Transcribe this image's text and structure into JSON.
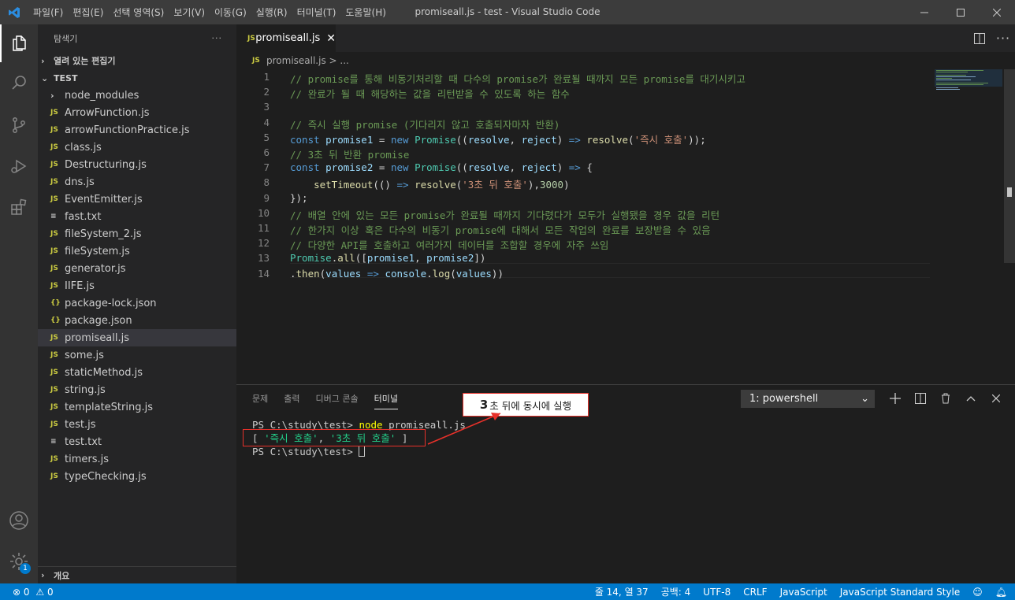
{
  "titlebar": {
    "menus": [
      "파일(F)",
      "편집(E)",
      "선택 영역(S)",
      "보기(V)",
      "이동(G)",
      "실행(R)",
      "터미널(T)",
      "도움말(H)"
    ],
    "title": "promiseall.js - test - Visual Studio Code"
  },
  "sidebar": {
    "header": "탐색기",
    "more": "···",
    "open_editors": "열려 있는 편집기",
    "folder": "TEST",
    "outline": "개요",
    "files": [
      {
        "name": "node_modules",
        "kind": "folder"
      },
      {
        "name": "ArrowFunction.js",
        "kind": "js"
      },
      {
        "name": "arrowFunctionPractice.js",
        "kind": "js"
      },
      {
        "name": "class.js",
        "kind": "js"
      },
      {
        "name": "Destructuring.js",
        "kind": "js"
      },
      {
        "name": "dns.js",
        "kind": "js"
      },
      {
        "name": "EventEmitter.js",
        "kind": "js"
      },
      {
        "name": "fast.txt",
        "kind": "txt"
      },
      {
        "name": "fileSystem_2.js",
        "kind": "js"
      },
      {
        "name": "fileSystem.js",
        "kind": "js"
      },
      {
        "name": "generator.js",
        "kind": "js"
      },
      {
        "name": "IIFE.js",
        "kind": "js"
      },
      {
        "name": "package-lock.json",
        "kind": "json"
      },
      {
        "name": "package.json",
        "kind": "json"
      },
      {
        "name": "promiseall.js",
        "kind": "js",
        "selected": true
      },
      {
        "name": "some.js",
        "kind": "js"
      },
      {
        "name": "staticMethod.js",
        "kind": "js"
      },
      {
        "name": "string.js",
        "kind": "js"
      },
      {
        "name": "templateString.js",
        "kind": "js"
      },
      {
        "name": "test.js",
        "kind": "js"
      },
      {
        "name": "test.txt",
        "kind": "txt"
      },
      {
        "name": "timers.js",
        "kind": "js"
      },
      {
        "name": "typeChecking.js",
        "kind": "js"
      }
    ]
  },
  "editor": {
    "tab": "promiseall.js",
    "breadcrumb": "promiseall.js > ...",
    "js_badge": "JS",
    "lines": [
      [
        [
          "c",
          "// promise를 통해 비동기처리할 때 다수의 promise가 완료될 때까지 모든 promise를 대기시키고"
        ]
      ],
      [
        [
          "c",
          "// 완료가 될 때 해당하는 값을 리턴받을 수 있도록 하는 함수"
        ]
      ],
      [],
      [
        [
          "c",
          "// 즉시 실행 promise (기다리지 않고 호출되자마자 반환)"
        ]
      ],
      [
        [
          "k",
          "const "
        ],
        [
          "v",
          "promise1"
        ],
        [
          "p",
          " = "
        ],
        [
          "k",
          "new "
        ],
        [
          "t",
          "Promise"
        ],
        [
          "p",
          "(("
        ],
        [
          "v",
          "resolve"
        ],
        [
          "p",
          ", "
        ],
        [
          "v",
          "reject"
        ],
        [
          "p",
          ") "
        ],
        [
          "k",
          "=> "
        ],
        [
          "f",
          "resolve"
        ],
        [
          "p",
          "("
        ],
        [
          "s",
          "'즉시 호출'"
        ],
        [
          "p",
          "));"
        ]
      ],
      [
        [
          "c",
          "// 3초 뒤 반환 promise"
        ]
      ],
      [
        [
          "k",
          "const "
        ],
        [
          "v",
          "promise2"
        ],
        [
          "p",
          " = "
        ],
        [
          "k",
          "new "
        ],
        [
          "t",
          "Promise"
        ],
        [
          "p",
          "(("
        ],
        [
          "v",
          "resolve"
        ],
        [
          "p",
          ", "
        ],
        [
          "v",
          "reject"
        ],
        [
          "p",
          ") "
        ],
        [
          "k",
          "=> "
        ],
        [
          "p",
          "{"
        ]
      ],
      [
        [
          "p",
          "    "
        ],
        [
          "f",
          "setTimeout"
        ],
        [
          "p",
          "(() "
        ],
        [
          "k",
          "=> "
        ],
        [
          "f",
          "resolve"
        ],
        [
          "p",
          "("
        ],
        [
          "s",
          "'3초 뒤 호출'"
        ],
        [
          "p",
          "),"
        ],
        [
          "n",
          "3000"
        ],
        [
          "p",
          ")"
        ]
      ],
      [
        [
          "p",
          "});"
        ]
      ],
      [
        [
          "c",
          "// 배열 안에 있는 모든 promise가 완료될 때까지 기다렸다가 모두가 실행됐을 경우 값을 리턴"
        ]
      ],
      [
        [
          "c",
          "// 한가지 이상 혹은 다수의 비동기 promise에 대해서 모든 작업의 완료를 보장받을 수 있음"
        ]
      ],
      [
        [
          "c",
          "// 다양한 API를 호출하고 여러가지 데이터를 조합할 경우에 자주 쓰임"
        ]
      ],
      [
        [
          "t",
          "Promise"
        ],
        [
          "p",
          "."
        ],
        [
          "f",
          "all"
        ],
        [
          "p",
          "(["
        ],
        [
          "v",
          "promise1"
        ],
        [
          "p",
          ", "
        ],
        [
          "v",
          "promise2"
        ],
        [
          "p",
          "])"
        ]
      ],
      [
        [
          "p",
          "."
        ],
        [
          "f",
          "then"
        ],
        [
          "p",
          "("
        ],
        [
          "v",
          "values"
        ],
        [
          "p",
          " "
        ],
        [
          "k",
          "=> "
        ],
        [
          "v",
          "console"
        ],
        [
          "p",
          "."
        ],
        [
          "f",
          "log"
        ],
        [
          "p",
          "("
        ],
        [
          "v",
          "values"
        ],
        [
          "p",
          "))"
        ]
      ]
    ]
  },
  "panel": {
    "tabs": [
      "문제",
      "출력",
      "디버그 콘솔",
      "터미널"
    ],
    "active_tab": "터미널",
    "shell": "1: powershell",
    "term_line1_prompt": "PS C:\\study\\test> ",
    "term_line1_cmd": "node",
    "term_line1_rest": " promiseall.js",
    "term_line2": "[ '즉시 호출', '3초 뒤 호출' ]",
    "term_line3": "PS C:\\study\\test> ",
    "annotation_big": "3",
    "annotation_rest": "초 뒤에 동시에 실행"
  },
  "statusbar": {
    "errors": "0",
    "warnings": "0",
    "position": "줄 14, 열 37",
    "spaces": "공백: 4",
    "encoding": "UTF-8",
    "eol": "CRLF",
    "language": "JavaScript",
    "linter": "JavaScript Standard Style"
  },
  "badges": {
    "settings": "1"
  }
}
